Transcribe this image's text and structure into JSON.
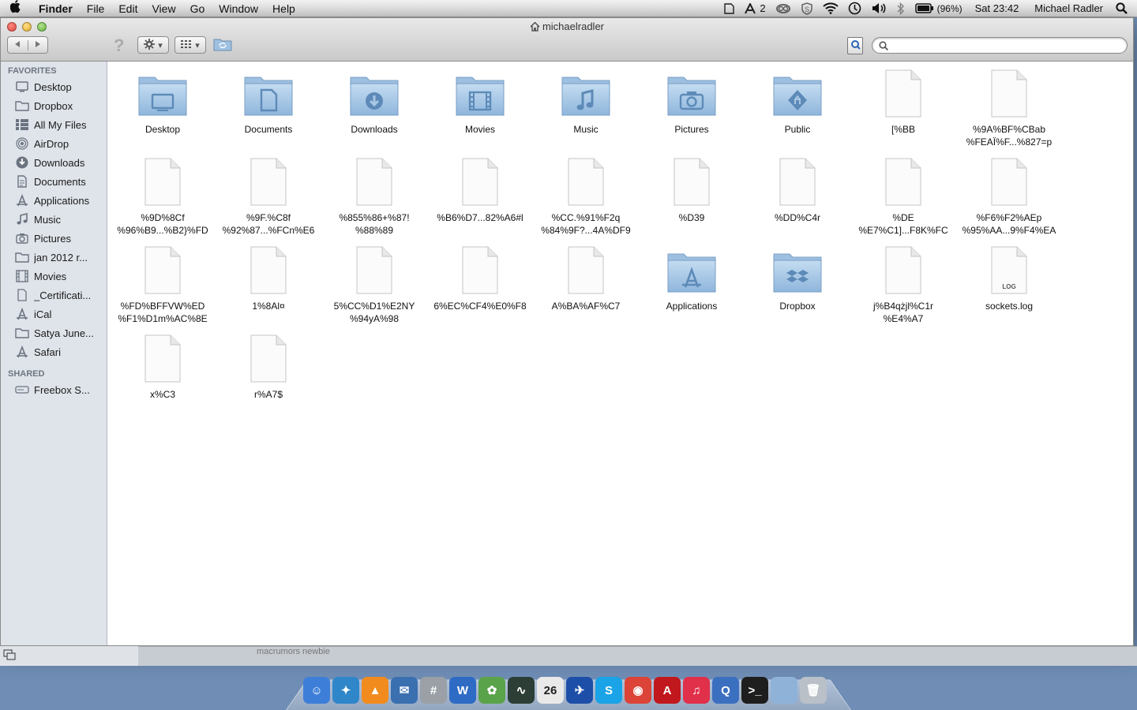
{
  "menubar": {
    "app": "Finder",
    "menus": [
      "File",
      "Edit",
      "View",
      "Go",
      "Window",
      "Help"
    ],
    "tray_count": "2",
    "battery": "(96%)",
    "clock": "Sat 23:42",
    "user": "Michael Radler"
  },
  "window": {
    "title": "michaelradler",
    "search_placeholder": ""
  },
  "sidebar": {
    "favorites_heading": "FAVORITES",
    "favorites": [
      {
        "label": "Desktop",
        "icon": "desktop-icon"
      },
      {
        "label": "Dropbox",
        "icon": "folder-icon"
      },
      {
        "label": "All My Files",
        "icon": "all-files-icon"
      },
      {
        "label": "AirDrop",
        "icon": "airdrop-icon"
      },
      {
        "label": "Downloads",
        "icon": "downloads-icon"
      },
      {
        "label": "Documents",
        "icon": "documents-icon"
      },
      {
        "label": "Applications",
        "icon": "applications-icon"
      },
      {
        "label": "Music",
        "icon": "music-icon"
      },
      {
        "label": "Pictures",
        "icon": "camera-icon"
      },
      {
        "label": "jan 2012 r...",
        "icon": "folder-icon"
      },
      {
        "label": "Movies",
        "icon": "movies-icon"
      },
      {
        "label": "_Certificati...",
        "icon": "document-icon"
      },
      {
        "label": "iCal",
        "icon": "applications-icon"
      },
      {
        "label": "Satya June...",
        "icon": "folder-icon"
      },
      {
        "label": "Safari",
        "icon": "applications-icon"
      }
    ],
    "shared_heading": "SHARED",
    "shared": [
      {
        "label": "Freebox S...",
        "icon": "server-icon"
      }
    ]
  },
  "files": [
    {
      "name": "Desktop",
      "kind": "folder",
      "glyph": "desktop"
    },
    {
      "name": "Documents",
      "kind": "folder",
      "glyph": "documents"
    },
    {
      "name": "Downloads",
      "kind": "folder",
      "glyph": "downloads"
    },
    {
      "name": "Movies",
      "kind": "folder",
      "glyph": "movies"
    },
    {
      "name": "Music",
      "kind": "folder",
      "glyph": "music"
    },
    {
      "name": "Pictures",
      "kind": "folder",
      "glyph": "pictures"
    },
    {
      "name": "Public",
      "kind": "folder",
      "glyph": "public"
    },
    {
      "name": "[%BB",
      "kind": "file"
    },
    {
      "name": "%9A%BF%CBab\n%FEAÏ%F...%827=p",
      "kind": "file"
    },
    {
      "name": "%9D%8Cf\n%96%B9...%B2}%FD",
      "kind": "file"
    },
    {
      "name": "%9F.%C8f\n%92%87...%FCn%E6",
      "kind": "file"
    },
    {
      "name": "%855%86+%87!\n%88%89",
      "kind": "file"
    },
    {
      "name": "%B6%D7...82%A6#l",
      "kind": "file"
    },
    {
      "name": "%CC.%91%F2q\n%84%9F?...4A%DF9",
      "kind": "file"
    },
    {
      "name": "%D39",
      "kind": "file"
    },
    {
      "name": "%DD%C4r",
      "kind": "file"
    },
    {
      "name": "%DE\n%E7%C1]...F8K%FC",
      "kind": "file"
    },
    {
      "name": "%F6%F2%AEp\n%95%AA...9%F4%EA",
      "kind": "file"
    },
    {
      "name": "%FD%BFFVW%ED\n%F1%D1m%AC%8E",
      "kind": "file"
    },
    {
      "name": "1%8Al¤",
      "kind": "file"
    },
    {
      "name": "5%CC%D1%E2NY\n%94yA%98",
      "kind": "file"
    },
    {
      "name": "6%EC%CF4%E0%F8",
      "kind": "file"
    },
    {
      "name": "A%BA%AF%C7",
      "kind": "file"
    },
    {
      "name": "Applications",
      "kind": "folder",
      "glyph": "applications"
    },
    {
      "name": "Dropbox",
      "kind": "folder",
      "glyph": "dropbox"
    },
    {
      "name": "j%B4qżjl%C1r\n%E4%A7",
      "kind": "file"
    },
    {
      "name": "sockets.log",
      "kind": "log",
      "badge": "LOG"
    },
    {
      "name": "x%C3",
      "kind": "file"
    },
    {
      "name": "r%A7$",
      "kind": "file"
    }
  ],
  "background": {
    "behind_text": "macrumors newbie"
  },
  "dock": {
    "calendar_day": "26",
    "apps": [
      {
        "name": "finder",
        "color": "#3d7fd8",
        "glyph": "☺"
      },
      {
        "name": "safari",
        "color": "#2f86c9",
        "glyph": "✦"
      },
      {
        "name": "vlc",
        "color": "#f28b1e",
        "glyph": "▲"
      },
      {
        "name": "thunderbird",
        "color": "#3a6fb0",
        "glyph": "✉"
      },
      {
        "name": "calculator",
        "color": "#9aa0a6",
        "glyph": "#"
      },
      {
        "name": "word",
        "color": "#2d6bc4",
        "glyph": "W"
      },
      {
        "name": "app-green",
        "color": "#5aa34a",
        "glyph": "✿"
      },
      {
        "name": "activity-monitor",
        "color": "#2c3e35",
        "glyph": "∿"
      },
      {
        "name": "calendar",
        "color": "#e9e9e9",
        "glyph": "26"
      },
      {
        "name": "app-blue",
        "color": "#1d4fa8",
        "glyph": "✈"
      },
      {
        "name": "skype",
        "color": "#1aa3e6",
        "glyph": "S"
      },
      {
        "name": "chrome",
        "color": "#db4437",
        "glyph": "◉"
      },
      {
        "name": "acrobat",
        "color": "#c0181d",
        "glyph": "A"
      },
      {
        "name": "itunes",
        "color": "#e0304a",
        "glyph": "♫"
      },
      {
        "name": "quicktime",
        "color": "#3b6fbf",
        "glyph": "Q"
      },
      {
        "name": "terminal",
        "color": "#1e1e1e",
        "glyph": ">_"
      },
      {
        "name": "folder",
        "color": "#8fb2d8",
        "glyph": ""
      },
      {
        "name": "trash",
        "color": "#b9c0c8",
        "glyph": "🗑"
      }
    ]
  }
}
